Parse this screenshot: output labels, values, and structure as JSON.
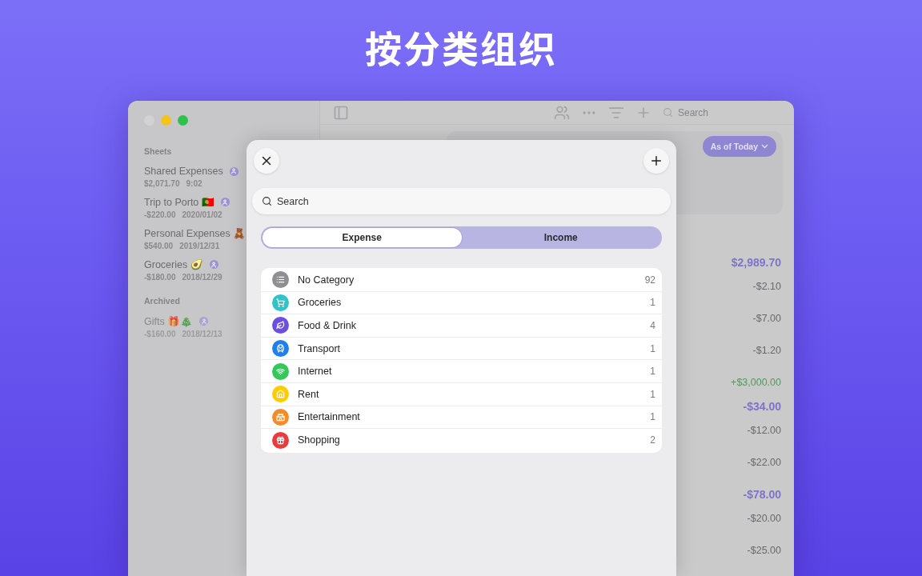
{
  "headline": "按分类组织",
  "sidebar": {
    "sections": [
      {
        "title": "Sheets",
        "archived": false,
        "sheets": [
          {
            "name": "Shared Expenses",
            "amount": "$2,071.70",
            "date": "9:02",
            "shared": true
          },
          {
            "name": "Trip to Porto 🇵🇹",
            "amount": "-$220.00",
            "date": "2020/01/02",
            "shared": true
          },
          {
            "name": "Personal Expenses 🧸",
            "amount": "$540.00",
            "date": "2019/12/31"
          },
          {
            "name": "Groceries 🥑",
            "amount": "-$180.00",
            "date": "2018/12/29",
            "shared": true
          }
        ]
      },
      {
        "title": "Archived",
        "archived": true,
        "sheets": [
          {
            "name": "Gifts 🎁🎄",
            "amount": "-$160.00",
            "date": "2018/12/13",
            "shared": true
          }
        ]
      }
    ]
  },
  "toolbar": {
    "search_placeholder": "Search"
  },
  "summary": {
    "period_button": "As of Today"
  },
  "amounts": [
    {
      "kind": "total",
      "text": "$2,989.70"
    },
    {
      "kind": "expense",
      "text": "-$2.10"
    },
    {
      "kind": "expense",
      "text": "-$7.00"
    },
    {
      "kind": "expense",
      "text": "-$1.20"
    },
    {
      "kind": "income",
      "text": "+$3,000.00"
    },
    {
      "kind": "total",
      "text": "-$34.00"
    },
    {
      "kind": "expense",
      "text": "-$12.00"
    },
    {
      "kind": "expense",
      "text": "-$22.00"
    },
    {
      "kind": "total",
      "text": "-$78.00"
    },
    {
      "kind": "expense",
      "text": "-$20.00"
    },
    {
      "kind": "expense",
      "text": "-$25.00"
    }
  ],
  "sheet": {
    "search_placeholder": "Search",
    "tabs": [
      {
        "label": "Expense",
        "selected": true
      },
      {
        "label": "Income",
        "selected": false
      }
    ],
    "categories": [
      {
        "name": "No Category",
        "count": "92",
        "color": "#8e8e93"
      },
      {
        "name": "Groceries",
        "count": "1",
        "color": "#2ec4c9"
      },
      {
        "name": "Food & Drink",
        "count": "4",
        "color": "#6a4fe0"
      },
      {
        "name": "Transport",
        "count": "1",
        "color": "#1f7ff0"
      },
      {
        "name": "Internet",
        "count": "1",
        "color": "#34c759"
      },
      {
        "name": "Rent",
        "count": "1",
        "color": "#ffcc00"
      },
      {
        "name": "Entertainment",
        "count": "1",
        "color": "#f28c2e"
      },
      {
        "name": "Shopping",
        "count": "2",
        "color": "#ec3b3b"
      }
    ]
  }
}
